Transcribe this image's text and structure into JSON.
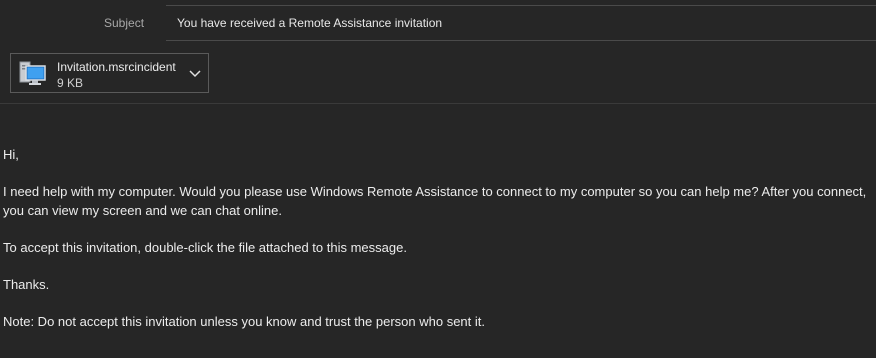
{
  "header": {
    "subject_label": "Subject",
    "subject_value": "You have received a Remote Assistance invitation"
  },
  "attachment": {
    "file_name": "Invitation.msrcincident",
    "file_size": "9 KB",
    "icon": "remote-assistance-computer-icon"
  },
  "message": {
    "greeting": "Hi,",
    "paragraph_1": "I need help with my computer. Would you please use Windows Remote Assistance to connect to my computer so you can help me? After you connect, you can view my screen and we can chat online.",
    "paragraph_2": "To accept this invitation, double-click the file attached to this message.",
    "closing": "Thanks.",
    "note": "Note:  Do not accept this invitation unless you know and trust the person who sent it."
  },
  "colors": {
    "background": "#262626",
    "text": "#e6e6e6",
    "muted_text": "#a8a8a8",
    "border": "#4a4a4a"
  }
}
